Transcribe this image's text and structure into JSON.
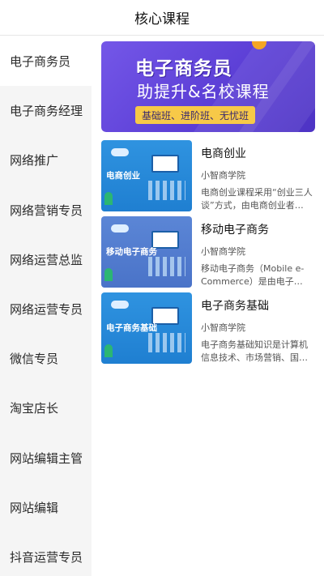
{
  "header": {
    "title": "核心课程"
  },
  "sidebar": {
    "items": [
      {
        "label": "电子商务员"
      },
      {
        "label": "电子商务经理"
      },
      {
        "label": "网络推广"
      },
      {
        "label": "网络营销专员"
      },
      {
        "label": "网络运营总监"
      },
      {
        "label": "网络运营专员"
      },
      {
        "label": "微信专员"
      },
      {
        "label": "淘宝店长"
      },
      {
        "label": "网站编辑主管"
      },
      {
        "label": "网站编辑"
      },
      {
        "label": "抖音运营专员"
      }
    ],
    "active_index": 0
  },
  "banner": {
    "title": "电子商务员",
    "subtitle": "助提升&名校课程",
    "tags": "基础班、进阶班、无忧班"
  },
  "courses": [
    {
      "thumb_label": "电商创业",
      "title": "电商创业",
      "source": "小智商学院",
      "desc": "电商创业课程采用“创业三人谈”方式，由电商创业者…"
    },
    {
      "thumb_label": "移动电子商务",
      "title": "移动电子商务",
      "source": "小智商学院",
      "desc": "移动电子商务（Mobile e-Commerce）是由电子…"
    },
    {
      "thumb_label": "电子商务基础",
      "title": "电子商务基础",
      "source": "小智商学院",
      "desc": "电子商务基础知识是计算机信息技术、市场营销、国…"
    }
  ]
}
